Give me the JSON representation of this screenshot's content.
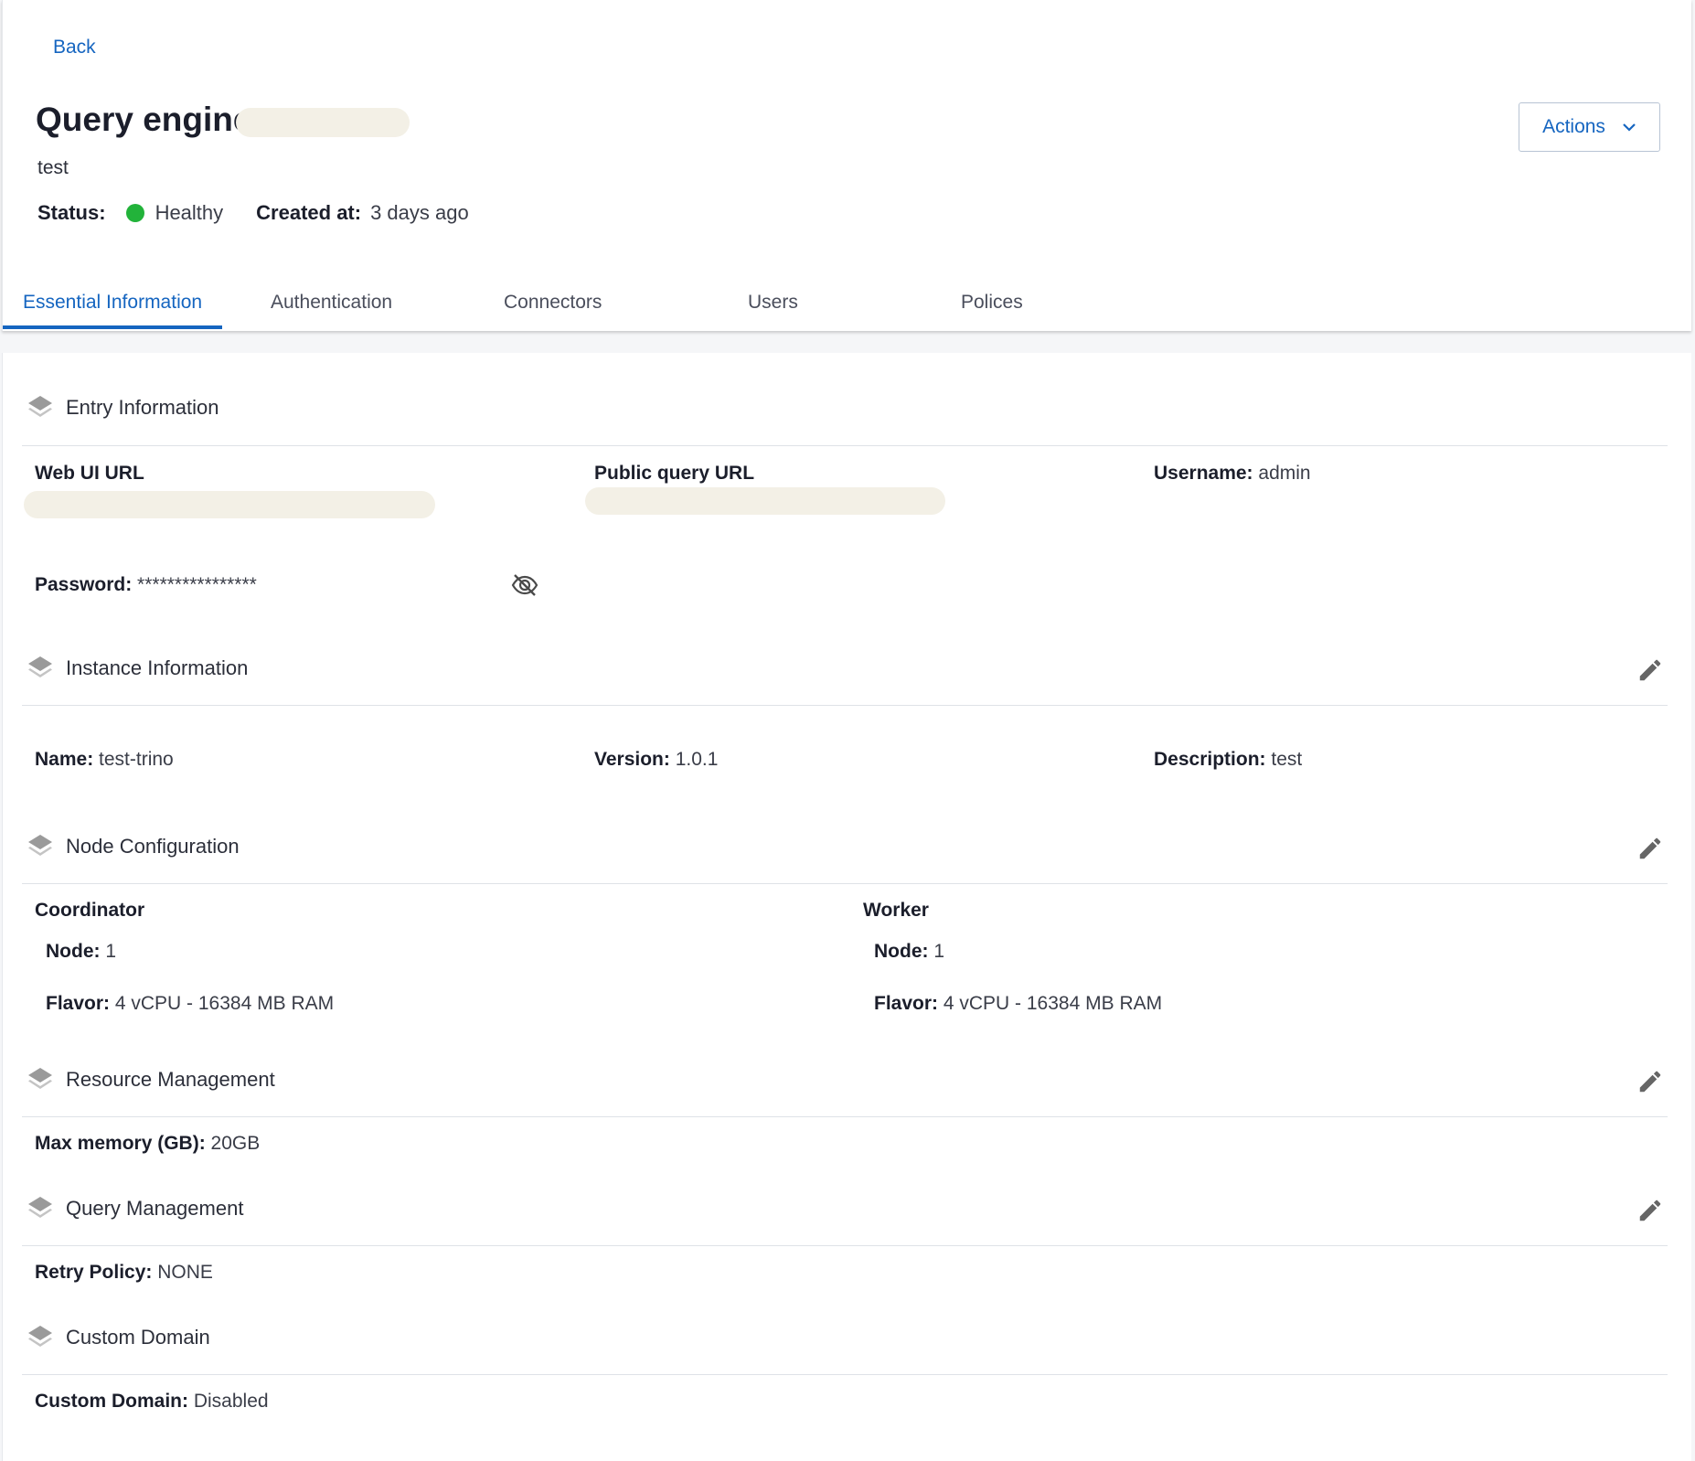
{
  "header": {
    "back_label": "Back",
    "title": "Query engine:",
    "subtitle": "test",
    "status_label": "Status:",
    "status_value": "Healthy",
    "status_color": "#22b33a",
    "created_label": "Created at:",
    "created_value": "3 days ago",
    "actions_label": "Actions"
  },
  "tabs": [
    {
      "label": "Essential Information",
      "active": true
    },
    {
      "label": "Authentication"
    },
    {
      "label": "Connectors"
    },
    {
      "label": "Users"
    },
    {
      "label": "Polices"
    }
  ],
  "entry": {
    "title": "Entry Information",
    "web_ui_label": "Web UI URL",
    "public_query_label": "Public query URL",
    "username_label": "Username:",
    "username_value": "admin",
    "password_label": "Password:",
    "password_value": "****************"
  },
  "instance": {
    "title": "Instance Information",
    "name_label": "Name:",
    "name_value": "test-trino",
    "version_label": "Version:",
    "version_value": "1.0.1",
    "description_label": "Description:",
    "description_value": "test"
  },
  "node": {
    "title": "Node Configuration",
    "coordinator_label": "Coordinator",
    "coordinator_node_label": "Node:",
    "coordinator_node_value": "1",
    "coordinator_flavor_label": "Flavor:",
    "coordinator_flavor_value": "4 vCPU - 16384 MB RAM",
    "worker_label": "Worker",
    "worker_node_label": "Node:",
    "worker_node_value": "1",
    "worker_flavor_label": "Flavor:",
    "worker_flavor_value": "4 vCPU - 16384 MB RAM"
  },
  "resource": {
    "title": "Resource Management",
    "max_memory_label": "Max memory (GB):",
    "max_memory_value": "20GB"
  },
  "query": {
    "title": "Query Management",
    "retry_label": "Retry Policy:",
    "retry_value": "NONE"
  },
  "domain": {
    "title": "Custom Domain",
    "custom_domain_label": "Custom Domain:",
    "custom_domain_value": "Disabled"
  },
  "icons": {
    "section": "layers-icon",
    "edit": "pencil-icon",
    "password_toggle": "eye-off-icon",
    "actions_caret": "chevron-down-icon"
  }
}
